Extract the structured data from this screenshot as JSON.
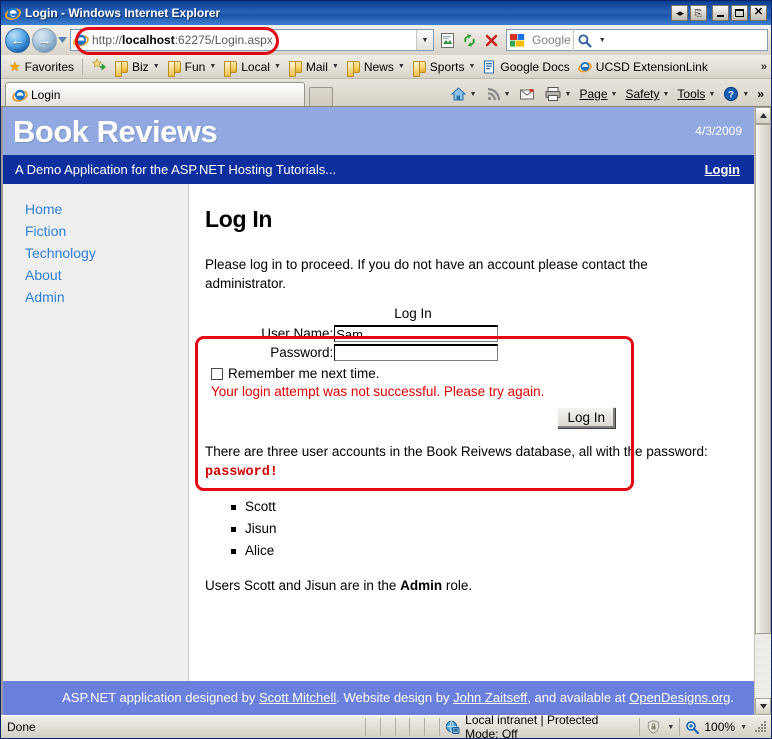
{
  "window": {
    "title": "Login - Windows Internet Explorer",
    "icon": "ie-logo-icon",
    "controls": {
      "resize_label": "◂▸",
      "restore_label": "❐",
      "minimize_label": "",
      "maximize_label": "",
      "close_label": "✕"
    }
  },
  "navbar": {
    "back_label": "←",
    "forward_label": "→",
    "history_caret": "▼",
    "address": {
      "protocol_host": "http://",
      "host_bold": "localhost",
      "rest": ":62275/Login.aspx",
      "full": "http://localhost:62275/Login.aspx",
      "dropdown_caret": "▼"
    },
    "compat_view_title": "Compatibility View",
    "refresh_title": "Refresh",
    "stop_title": "Stop",
    "search": {
      "placeholder": "Google",
      "provider": "Google",
      "go_caret": "▼"
    }
  },
  "favorites_bar": {
    "favorites_label": "Favorites",
    "add_to_favorites_title": "Add to Favorites Bar",
    "items": [
      {
        "label": "Biz",
        "has_caret": true,
        "icon": "folder-icon"
      },
      {
        "label": "Fun",
        "has_caret": true,
        "icon": "folder-icon"
      },
      {
        "label": "Local",
        "has_caret": true,
        "icon": "folder-icon"
      },
      {
        "label": "Mail",
        "has_caret": true,
        "icon": "folder-icon"
      },
      {
        "label": "News",
        "has_caret": true,
        "icon": "folder-icon"
      },
      {
        "label": "Sports",
        "has_caret": true,
        "icon": "folder-icon"
      },
      {
        "label": "Google Docs",
        "has_caret": false,
        "icon": "document-icon"
      },
      {
        "label": "UCSD ExtensionLink",
        "has_caret": false,
        "icon": "ie-logo-icon"
      }
    ],
    "overflow_label": "»"
  },
  "tabs": {
    "items": [
      {
        "label": "Login",
        "icon": "ie-logo-icon"
      }
    ],
    "new_tab_title": "New Tab"
  },
  "command_bar": {
    "home_label": "Home",
    "feeds_label": "Feeds",
    "mail_label": "Read Mail",
    "print_label": "Print",
    "items": [
      {
        "label": "Page",
        "accel": "P"
      },
      {
        "label": "Safety",
        "accel": "S"
      },
      {
        "label": "Tools",
        "accel": "o"
      }
    ],
    "help_label": "Help",
    "overflow_label": "»",
    "caret": "▼"
  },
  "site": {
    "title": "Book Reviews",
    "date": "4/3/2009",
    "tagline": "A Demo Application for the ASP.NET Hosting Tutorials...",
    "login_link": "Login",
    "nav": [
      {
        "label": "Home"
      },
      {
        "label": "Fiction"
      },
      {
        "label": "Technology"
      },
      {
        "label": "About"
      },
      {
        "label": "Admin"
      }
    ],
    "colors": {
      "header_bg": "#91a8e0",
      "subheader_bg": "#0f2f9e",
      "footer_bg": "#6a80dc",
      "link": "#2e7fd6",
      "error": "#e00000",
      "annotation": "#e30613"
    },
    "main": {
      "heading": "Log In",
      "intro": "Please log in to proceed. If you do not have an account please contact the administrator.",
      "login_widget": {
        "title": "Log In",
        "username_label": "User Name:",
        "username_value": "Sam",
        "password_label": "Password:",
        "password_value": "",
        "remember_label": "Remember me next time.",
        "remember_checked": false,
        "error_message": "Your login attempt was not successful. Please try again.",
        "submit_label": "Log In"
      },
      "accounts_intro_prefix": "There are three user accounts in the Book Reivews database, all with the password: ",
      "accounts_password": "password!",
      "accounts": [
        "Scott",
        "Jisun",
        "Alice"
      ],
      "role_note_prefix": "Users Scott and Jisun are in the ",
      "role_note_bold": "Admin",
      "role_note_suffix": " role."
    },
    "footer": {
      "text_1": "ASP.NET application designed by ",
      "link_1": "Scott Mitchell",
      "text_2": ". Website design by ",
      "link_2": "John Zaitseff",
      "text_3": ", and available at ",
      "link_3": "OpenDesigns.org",
      "text_4": "."
    }
  },
  "scrollbar": {
    "up_label": "▲",
    "down_label": "▼"
  },
  "statusbar": {
    "status": "Done",
    "zone": "Local intranet | Protected Mode: Off",
    "zone_icon": "globe-icon",
    "protected_icon": "shield-icon",
    "zoom": "100%",
    "zoom_icon": "magnifier-icon",
    "caret": "▼"
  }
}
